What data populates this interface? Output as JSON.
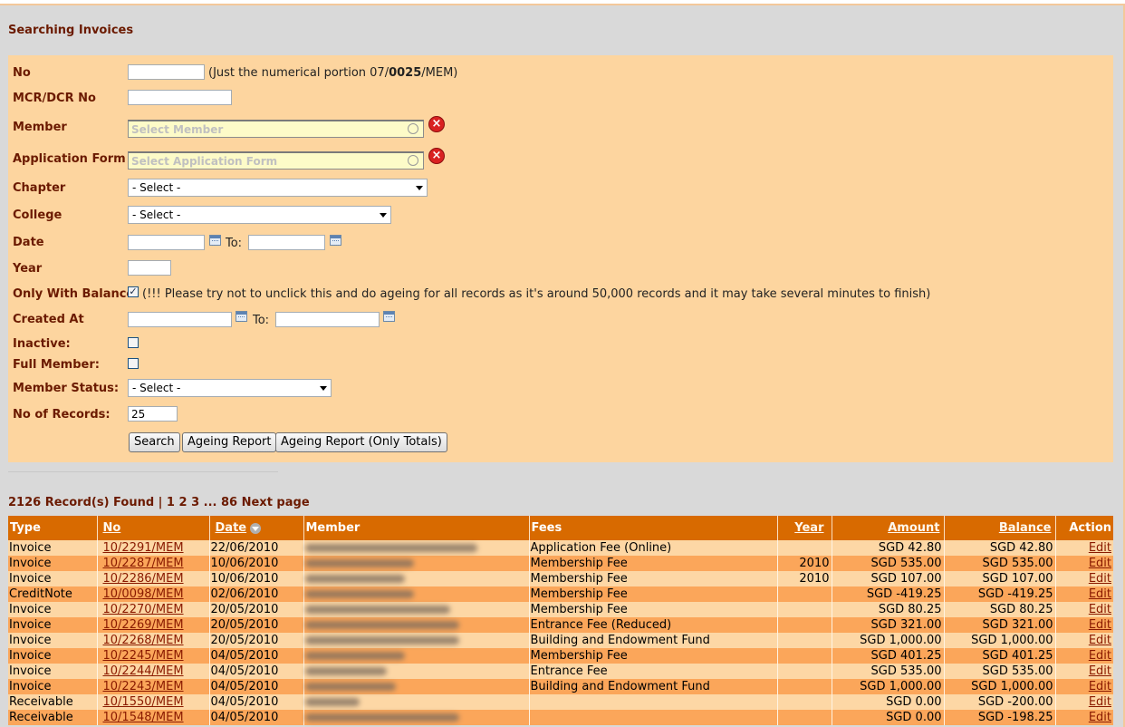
{
  "page_title": "Searching Invoices",
  "form": {
    "no_label": "No",
    "no_hint_pre": "(Just the numerical portion 07/",
    "no_hint_bold": "0025",
    "no_hint_post": "/MEM)",
    "mcr_label": "MCR/DCR No",
    "member_label": "Member",
    "member_placeholder": "Select Member",
    "appform_label": "Application Form",
    "appform_placeholder": "Select Application Form",
    "chapter_label": "Chapter",
    "chapter_value": "- Select -",
    "college_label": "College",
    "college_value": "- Select -",
    "date_label": "Date",
    "to_label": "To:",
    "year_label": "Year",
    "balance_label": "Only With Balance",
    "balance_note": "(!!! Please try not to unclick this and do ageing for all records as it's around 50,000 records and it may take several minutes to finish)",
    "created_label": "Created At",
    "inactive_label": "Inactive:",
    "fullmember_label": "Full Member:",
    "memberstatus_label": "Member Status:",
    "memberstatus_value": "- Select -",
    "records_label": "No of Records:",
    "records_value": "25",
    "search_button": "Search",
    "ageing_button": "Ageing Report",
    "ageing_totals_button": "Ageing Report (Only Totals)"
  },
  "summary": "2126 Record(s) Found | 1 2 3 ... 86 Next page",
  "table": {
    "headers": [
      "Type",
      "No",
      "Date",
      "Member",
      "Fees",
      "Year",
      "Amount",
      "Balance",
      "Action"
    ],
    "rows": [
      {
        "type": "Invoice",
        "no": "10/2291/MEM",
        "date": "22/06/2010",
        "fees": "Application Fee (Online)",
        "year": "",
        "amount": "SGD 42.80",
        "balance": "SGD 42.80",
        "action": "Edit"
      },
      {
        "type": "Invoice",
        "no": "10/2287/MEM",
        "date": "10/06/2010",
        "fees": "Membership Fee",
        "year": "2010",
        "amount": "SGD 535.00",
        "balance": "SGD 535.00",
        "action": "Edit"
      },
      {
        "type": "Invoice",
        "no": "10/2286/MEM",
        "date": "10/06/2010",
        "fees": "Membership Fee",
        "year": "2010",
        "amount": "SGD 107.00",
        "balance": "SGD 107.00",
        "action": "Edit"
      },
      {
        "type": "CreditNote",
        "no": "10/0098/MEM",
        "date": "02/06/2010",
        "fees": "Membership Fee",
        "year": "",
        "amount": "SGD -419.25",
        "balance": "SGD -419.25",
        "action": "Edit"
      },
      {
        "type": "Invoice",
        "no": "10/2270/MEM",
        "date": "20/05/2010",
        "fees": "Membership Fee",
        "year": "",
        "amount": "SGD 80.25",
        "balance": "SGD 80.25",
        "action": "Edit"
      },
      {
        "type": "Invoice",
        "no": "10/2269/MEM",
        "date": "20/05/2010",
        "fees": "Entrance Fee (Reduced)",
        "year": "",
        "amount": "SGD 321.00",
        "balance": "SGD 321.00",
        "action": "Edit"
      },
      {
        "type": "Invoice",
        "no": "10/2268/MEM",
        "date": "20/05/2010",
        "fees": "Building and Endowment Fund",
        "year": "",
        "amount": "SGD 1,000.00",
        "balance": "SGD 1,000.00",
        "action": "Edit"
      },
      {
        "type": "Invoice",
        "no": "10/2245/MEM",
        "date": "04/05/2010",
        "fees": "Membership Fee",
        "year": "",
        "amount": "SGD 401.25",
        "balance": "SGD 401.25",
        "action": "Edit"
      },
      {
        "type": "Invoice",
        "no": "10/2244/MEM",
        "date": "04/05/2010",
        "fees": "Entrance Fee",
        "year": "",
        "amount": "SGD 535.00",
        "balance": "SGD 535.00",
        "action": "Edit"
      },
      {
        "type": "Invoice",
        "no": "10/2243/MEM",
        "date": "04/05/2010",
        "fees": "Building and Endowment Fund",
        "year": "",
        "amount": "SGD 1,000.00",
        "balance": "SGD 1,000.00",
        "action": "Edit"
      },
      {
        "type": "Receivable",
        "no": "10/1550/MEM",
        "date": "04/05/2010",
        "fees": "",
        "year": "",
        "amount": "SGD 0.00",
        "balance": "SGD -200.00",
        "action": "Edit"
      },
      {
        "type": "Receivable",
        "no": "10/1548/MEM",
        "date": "04/05/2010",
        "fees": "",
        "year": "",
        "amount": "SGD 0.00",
        "balance": "SGD -198.25",
        "action": "Edit"
      }
    ]
  }
}
